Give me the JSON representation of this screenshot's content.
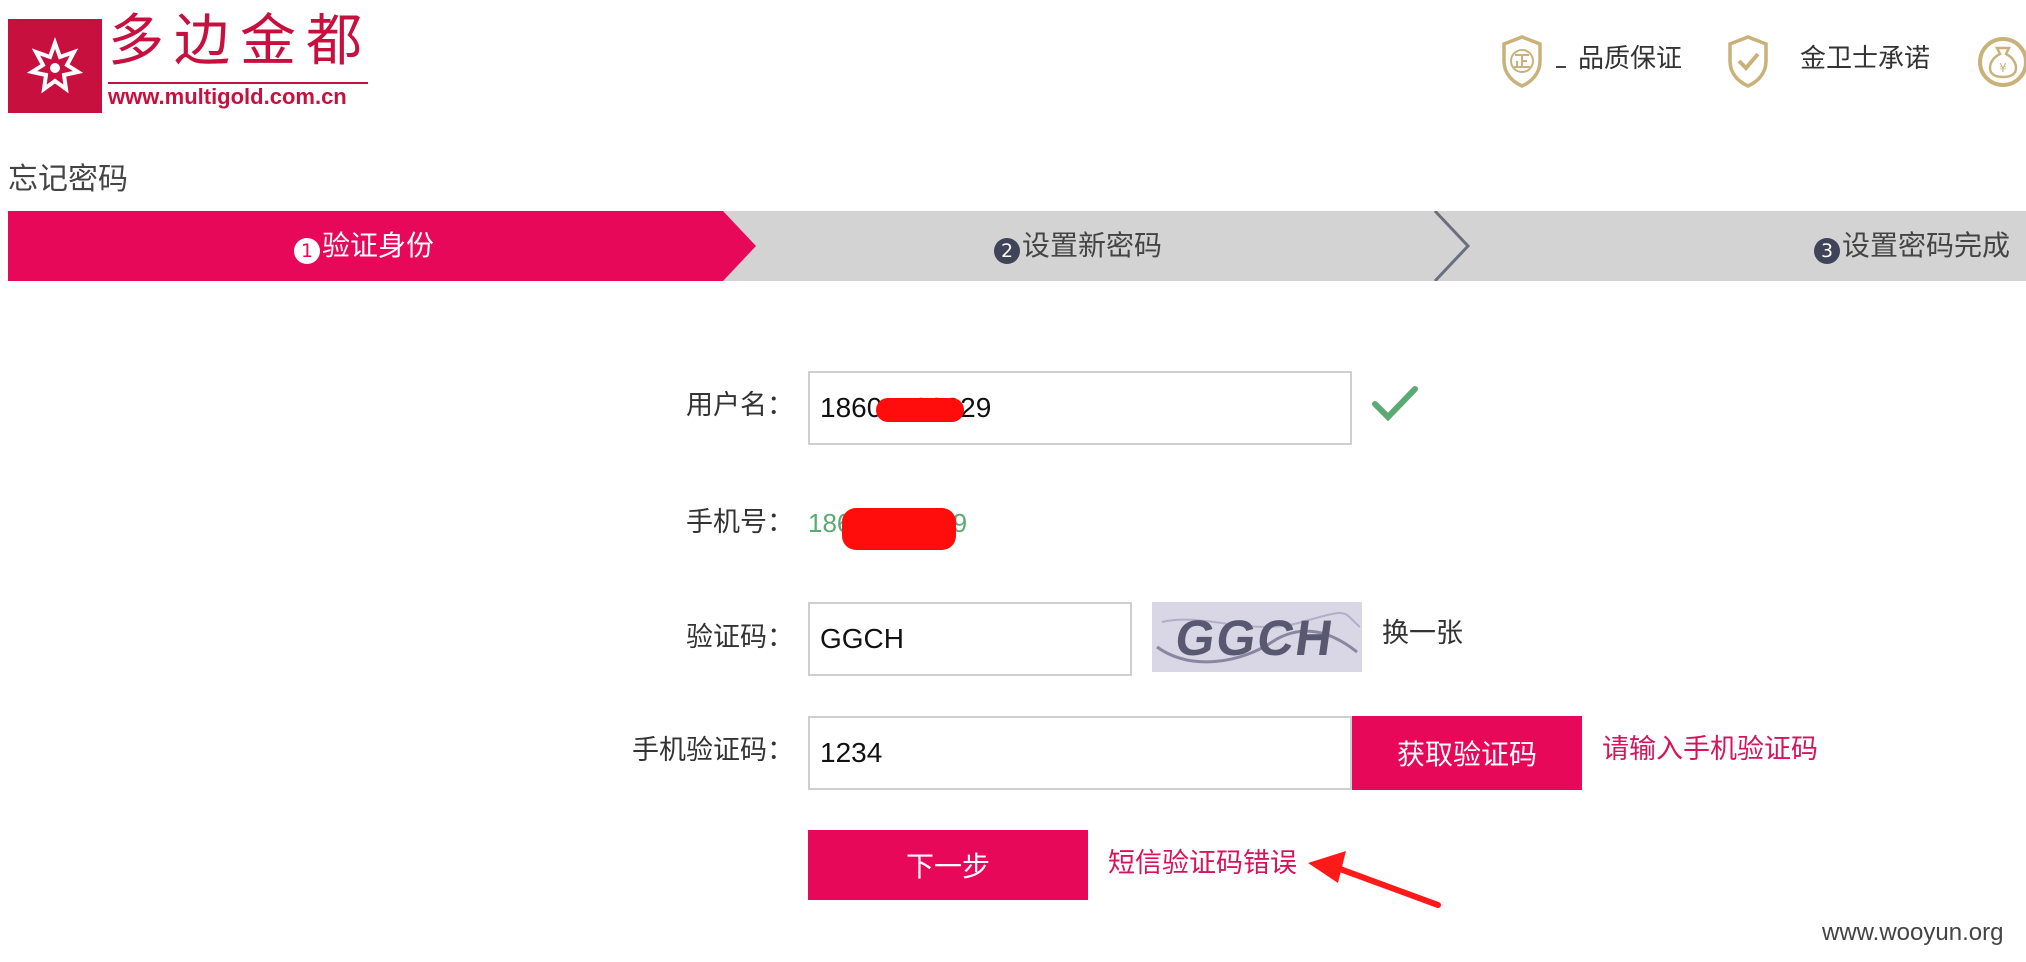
{
  "brand": {
    "name": "多边金都",
    "url": "www.multigold.com.cn",
    "color": "#c8103f"
  },
  "header": {
    "guarantees": [
      {
        "label": "品质保证",
        "icon": "shield-zheng-icon"
      },
      {
        "label": "金卫士承诺",
        "icon": "shield-check-icon"
      },
      {
        "label": "",
        "icon": "money-bag-icon"
      }
    ],
    "icon_color": "#c9b27a"
  },
  "page": {
    "title": "忘记密码"
  },
  "steps": [
    {
      "num": "1",
      "label": "验证身份",
      "active": true
    },
    {
      "num": "2",
      "label": "设置新密码",
      "active": false
    },
    {
      "num": "3",
      "label": "设置密码完成",
      "active": false
    }
  ],
  "colors": {
    "accent": "#e8085a",
    "inactive_step": "#d3d3d3",
    "success": "#5aab73",
    "error": "#d6145c"
  },
  "form": {
    "username": {
      "label": "用户名：",
      "value": "18604400029",
      "valid": true
    },
    "phone": {
      "label": "手机号：",
      "value": "18604400029"
    },
    "captcha": {
      "label": "验证码：",
      "value": "GGCH",
      "image_text": "GGCH",
      "refresh": "换一张"
    },
    "sms": {
      "label": "手机验证码：",
      "value": "1234",
      "button": "获取验证码",
      "hint": "请输入手机验证码"
    },
    "submit": {
      "label": "下一步",
      "error": "短信验证码错误"
    }
  },
  "watermark": "www.wooyun.org"
}
